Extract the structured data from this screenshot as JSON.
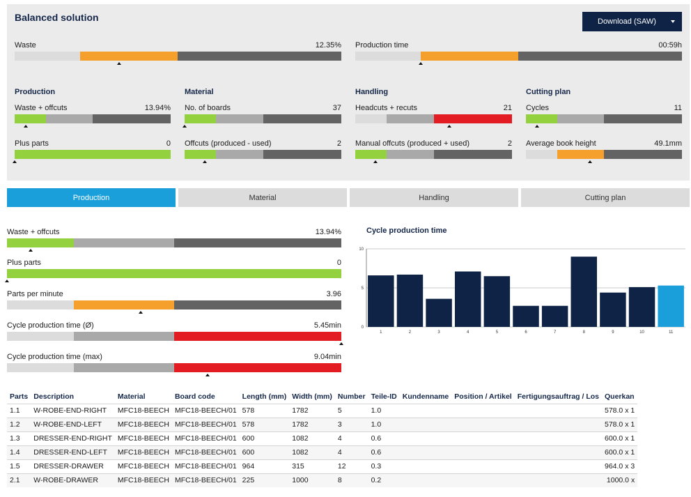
{
  "header": {
    "title": "Balanced solution",
    "download_label": "Download (SAW)"
  },
  "top_metrics": {
    "waste": {
      "label": "Waste",
      "value": "12.35%",
      "pointer": 0.32
    },
    "production_time": {
      "label": "Production time",
      "value": "00:59h",
      "pointer": 0.2
    }
  },
  "groups": {
    "production": {
      "heading": "Production",
      "m1": {
        "label": "Waste + offcuts",
        "value": "13.94%",
        "pointer": 0.07
      },
      "m2": {
        "label": "Plus parts",
        "value": "0",
        "pointer": 0.0
      }
    },
    "material": {
      "heading": "Material",
      "m1": {
        "label": "No. of boards",
        "value": "37",
        "pointer": 0.0
      },
      "m2": {
        "label": "Offcuts (produced - used)",
        "value": "2",
        "pointer": 0.13
      }
    },
    "handling": {
      "heading": "Handling",
      "m1": {
        "label": "Headcuts + recuts",
        "value": "21",
        "pointer": 0.6
      },
      "m2": {
        "label": "Manual offcuts (produced + used)",
        "value": "2",
        "pointer": 0.13
      }
    },
    "cutting": {
      "heading": "Cutting plan",
      "m1": {
        "label": "Cycles",
        "value": "11",
        "pointer": 0.07
      },
      "m2": {
        "label": "Average book height",
        "value": "49.1mm",
        "pointer": 0.41
      }
    }
  },
  "tabs": [
    "Production",
    "Material",
    "Handling",
    "Cutting plan"
  ],
  "detail_metrics": [
    {
      "label": "Waste + offcuts",
      "value": "13.94%",
      "pointer": 0.07
    },
    {
      "label": "Plus parts",
      "value": "0",
      "pointer": 0.0
    },
    {
      "label": "Parts per minute",
      "value": "3.96",
      "pointer": 0.4
    },
    {
      "label": "Cycle production time (Ø)",
      "value": "5.45min",
      "pointer": 1.0
    },
    {
      "label": "Cycle production time (max)",
      "value": "9.04min",
      "pointer": 0.6
    }
  ],
  "colors": {
    "green": "#94d13e",
    "orange": "#f5a02c",
    "red": "#e31b23",
    "light": "#dcdcdc",
    "mid": "#a9a9a9",
    "dark": "#636363",
    "navy": "#0f2346",
    "highlight": "#1a9fdb"
  },
  "chart_data": {
    "type": "bar",
    "title": "Cycle production time",
    "categories": [
      "1",
      "2",
      "3",
      "4",
      "5",
      "6",
      "7",
      "8",
      "9",
      "10",
      "11"
    ],
    "values": [
      6.6,
      6.7,
      3.6,
      7.1,
      6.5,
      2.7,
      2.7,
      9.0,
      4.4,
      5.1,
      5.3
    ],
    "highlight_index": 10,
    "ylim": [
      0,
      10
    ],
    "yticks": [
      "0",
      "5",
      "10"
    ],
    "grid": true
  },
  "table": {
    "headers": [
      "Parts",
      "Description",
      "Material",
      "Board code",
      "Length (mm)",
      "Width (mm)",
      "Number",
      "Teile-ID",
      "Kundenname",
      "Position / Artikel",
      "Fertigungsauftrag / Los",
      "Querkan"
    ],
    "rows": [
      [
        "1.1",
        "W-ROBE-END-RIGHT",
        "MFC18-BEECH",
        "MFC18-BEECH/01",
        "578",
        "1782",
        "5",
        "1.0",
        "",
        "",
        "",
        "578.0 x 1"
      ],
      [
        "1.2",
        "W-ROBE-END-LEFT",
        "MFC18-BEECH",
        "MFC18-BEECH/01",
        "578",
        "1782",
        "3",
        "1.0",
        "",
        "",
        "",
        "578.0 x 1"
      ],
      [
        "1.3",
        "DRESSER-END-RIGHT",
        "MFC18-BEECH",
        "MFC18-BEECH/01",
        "600",
        "1082",
        "4",
        "0.6",
        "",
        "",
        "",
        "600.0 x 1"
      ],
      [
        "1.4",
        "DRESSER-END-LEFT",
        "MFC18-BEECH",
        "MFC18-BEECH/01",
        "600",
        "1082",
        "4",
        "0.6",
        "",
        "",
        "",
        "600.0 x 1"
      ],
      [
        "1.5",
        "DRESSER-DRAWER",
        "MFC18-BEECH",
        "MFC18-BEECH/01",
        "964",
        "315",
        "12",
        "0.3",
        "",
        "",
        "",
        "964.0 x 3"
      ],
      [
        "2.1",
        "W-ROBE-DRAWER",
        "MFC18-BEECH",
        "MFC18-BEECH/01",
        "225",
        "1000",
        "8",
        "0.2",
        "",
        "",
        "",
        "1000.0 x"
      ]
    ]
  }
}
